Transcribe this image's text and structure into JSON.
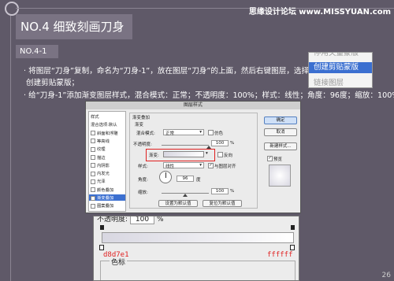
{
  "watermark": "思缘设计论坛 www.MISSYUAN.com",
  "header": {
    "title": "NO.4 细致刻画刀身"
  },
  "section": {
    "label": "NO.4-1"
  },
  "body": {
    "line1": "· 将图层“刀身”复制，命名为“刀身-1”，放在图层“刀身”的上面，然后右键图层，选择",
    "line2": "创建剪贴蒙版；",
    "line3": "· 给“刀身-1”添加渐变图层样式，混合模式：正常；不透明度：100%；样式：线性；角度：96度；缩放：100%；"
  },
  "context_menu": {
    "items": [
      "停用矢量蒙版",
      "创建剪贴蒙版",
      "链接图层"
    ],
    "selected_index": 1
  },
  "dialog": {
    "title": "图层样式",
    "left_panel": {
      "items": [
        {
          "label": "样式",
          "checkbox": false,
          "active": false
        },
        {
          "label": "混合选项:默认",
          "checkbox": false,
          "active": false
        },
        {
          "label": "斜面和浮雕",
          "checkbox": true,
          "active": false
        },
        {
          "label": "等高线",
          "checkbox": true,
          "active": false
        },
        {
          "label": "纹理",
          "checkbox": true,
          "active": false
        },
        {
          "label": "描边",
          "checkbox": true,
          "active": false
        },
        {
          "label": "内阴影",
          "checkbox": true,
          "active": false
        },
        {
          "label": "内发光",
          "checkbox": true,
          "active": false
        },
        {
          "label": "光泽",
          "checkbox": true,
          "active": false
        },
        {
          "label": "颜色叠加",
          "checkbox": true,
          "active": false
        },
        {
          "label": "渐变叠加",
          "checkbox": true,
          "active": true
        },
        {
          "label": "图案叠加",
          "checkbox": true,
          "active": false
        }
      ]
    },
    "gradient_overlay": {
      "group_title": "渐变叠加",
      "sub_title": "渐变",
      "blend_mode_label": "混合模式:",
      "blend_mode_value": "正常",
      "dither_label": "仿色",
      "opacity_label": "不透明度:",
      "opacity_value": "100",
      "opacity_unit": "%",
      "opacity_level": 1.0,
      "gradient_label": "渐变:",
      "reverse_label": "反向",
      "style_label": "样式:",
      "style_value": "线性",
      "align_label": "与图层对齐",
      "angle_label": "角度:",
      "angle_value": "96",
      "angle_unit": "度",
      "scale_label": "缩放:",
      "scale_value": "100",
      "scale_unit": "%",
      "scale_level": 0.5,
      "default_button": "设置为默认值",
      "reset_button": "复位为默认值"
    },
    "right_buttons": {
      "ok": "确定",
      "cancel": "取消",
      "new_style": "新建样式...",
      "preview": "预览"
    }
  },
  "gradient_editor": {
    "top_label": "不透明度:",
    "top_value": "100",
    "top_unit": "%",
    "left_color": "d8d7e1",
    "right_color": "ffffff",
    "stops_title": "色标"
  },
  "colors": {
    "background": "#5f5968",
    "accent": "#3b6fd0",
    "gradient_left": "#d8d7e1",
    "gradient_right": "#ffffff",
    "hex_label": "#e02020"
  },
  "page_number": "26"
}
